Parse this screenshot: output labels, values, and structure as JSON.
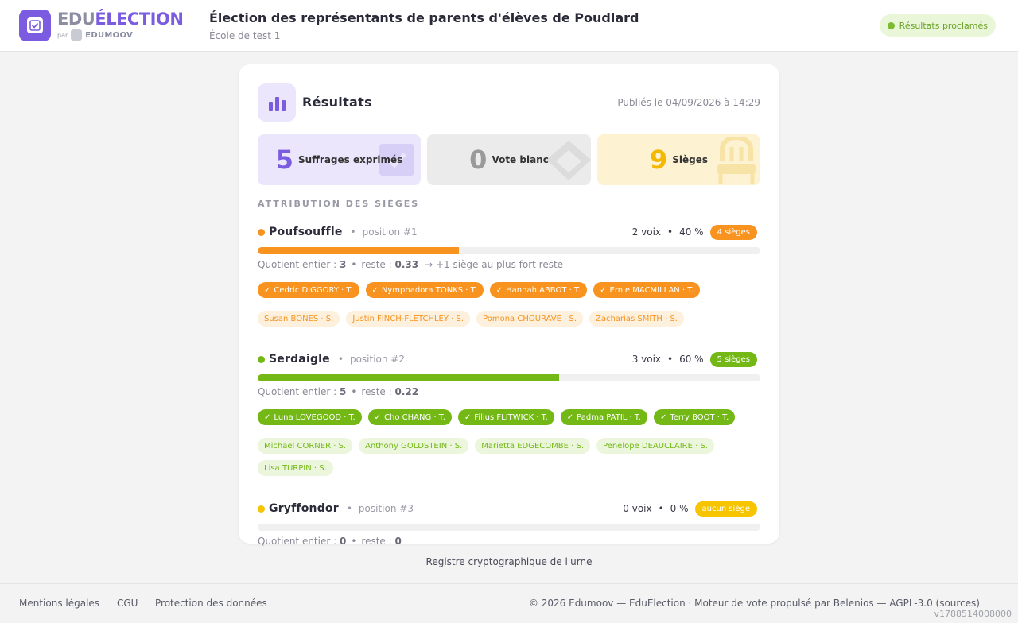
{
  "header": {
    "brand_edu": "EDU",
    "brand_election": "ÉLECTION",
    "brand_par": "par",
    "brand_edumoov": "EDUMOOV",
    "title": "Élection des représentants de parents d'élèves de Poudlard",
    "subtitle": "École de test 1",
    "status": "Résultats proclamés"
  },
  "results": {
    "title": "Résultats",
    "published": "Publiés le 04/09/2026 à 14:29",
    "stats": [
      {
        "num": "5",
        "label": "Suffrages exprimés"
      },
      {
        "num": "0",
        "label": "Vote blanc"
      },
      {
        "num": "9",
        "label": "Sièges"
      }
    ],
    "section_label": "ATTRIBUTION DES SIÈGES"
  },
  "parties": [
    {
      "name": "Poufsouffle",
      "position": "position #1",
      "votes": "2 voix",
      "percent": "40 %",
      "seats": "4 sièges",
      "share": 0.4,
      "color": "#f7931e",
      "light": "#fdf0dd",
      "quotient_label": "Quotient entier :",
      "quotient": "3",
      "reste_label": "reste :",
      "reste": "0.33",
      "extra": "→  +1 siège au plus fort reste",
      "elected": [
        "Cedric DIGGORY · T.",
        "Nymphadora TONKS · T.",
        "Hannah ABBOT · T.",
        "Ernie MACMILLAN · T."
      ],
      "substitutes": [
        "Susan BONES · S.",
        "Justin FINCH-FLETCHLEY · S.",
        "Pomona CHOURAVE · S.",
        "Zacharias SMITH · S."
      ]
    },
    {
      "name": "Serdaigle",
      "position": "position #2",
      "votes": "3 voix",
      "percent": "60 %",
      "seats": "5 sièges",
      "share": 0.6,
      "color": "#74b816",
      "light": "#ebf6dc",
      "quotient_label": "Quotient entier :",
      "quotient": "5",
      "reste_label": "reste :",
      "reste": "0.22",
      "extra": "",
      "elected": [
        "Luna LOVEGOOD · T.",
        "Cho CHANG · T.",
        "Filius FLITWICK · T.",
        "Padma PATIL · T.",
        "Terry BOOT · T."
      ],
      "substitutes": [
        "Michael CORNER · S.",
        "Anthony GOLDSTEIN · S.",
        "Marietta EDGECOMBE · S.",
        "Penelope DEAUCLAIRE · S.",
        "Lisa TURPIN · S."
      ]
    },
    {
      "name": "Gryffondor",
      "position": "position #3",
      "votes": "0 voix",
      "percent": "0 %",
      "seats": "aucun siège",
      "share": 0,
      "color": "#f7c400",
      "light": "#fdf5d6",
      "quotient_label": "Quotient entier :",
      "quotient": "0",
      "reste_label": "reste :",
      "reste": "0",
      "extra": "",
      "elected": [],
      "substitutes": []
    }
  ],
  "footer": {
    "link": "Registre cryptographique de l'urne",
    "legal": "Mentions légales",
    "cgu": "CGU",
    "privacy": "Protection des données",
    "copyright": "© 2026 Edumoov — EduÉlection · Moteur de vote propulsé par Belenios — AGPL-3.0 (sources)",
    "version": "v1788514008000"
  }
}
